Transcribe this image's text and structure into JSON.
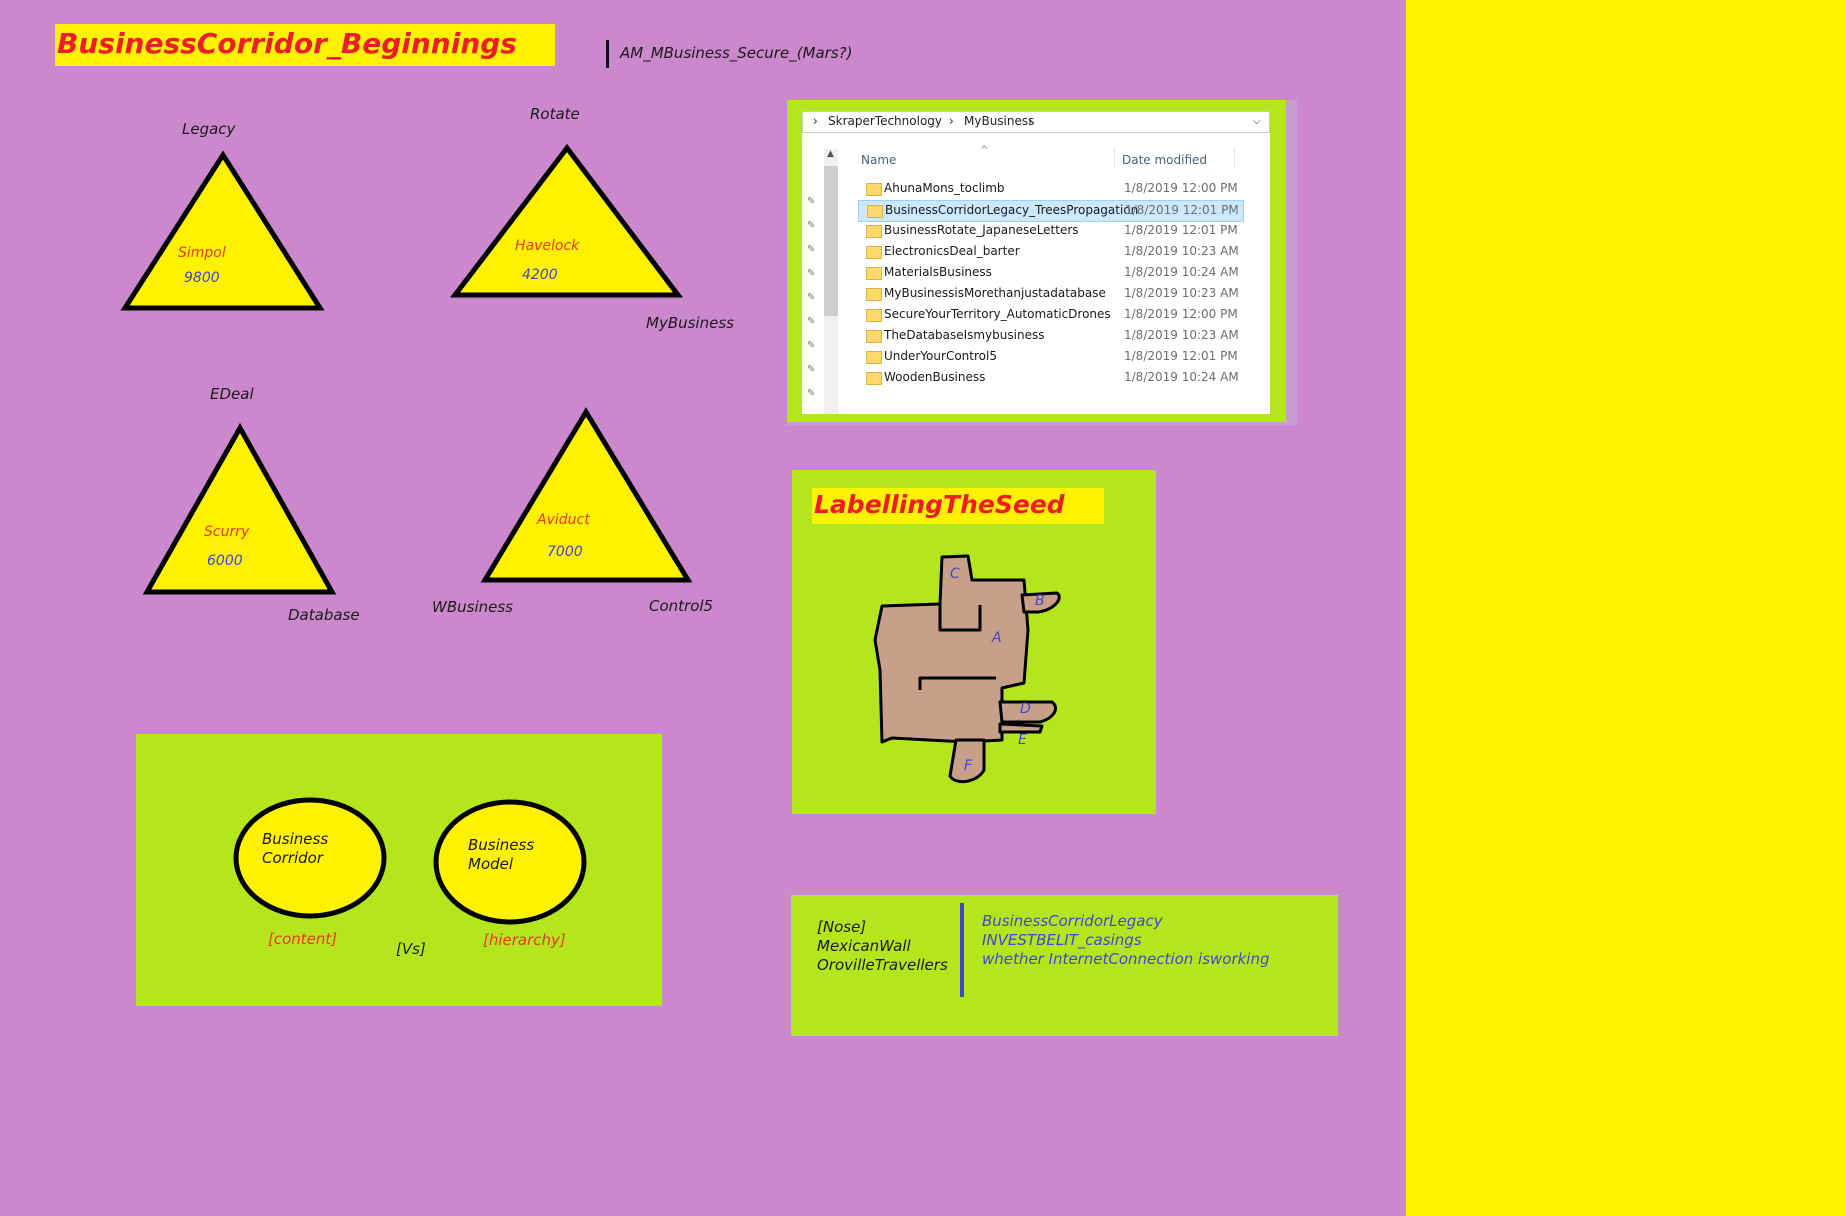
{
  "main_title": "BusinessCorridor_Beginnings",
  "subtitle": "AM_MBusiness_Secure_(Mars?)",
  "triangles": [
    {
      "top_label": "Legacy",
      "name": "Simpol",
      "value": "9800"
    },
    {
      "top_label": "Rotate",
      "name": "Havelock",
      "value": "4200",
      "corner_label": "MyBusiness"
    },
    {
      "top_label": "EDeal",
      "name": "Scurry",
      "value": "6000",
      "corner_label": "Database"
    },
    {
      "name": "Aviduct",
      "value": "7000",
      "left_label": "WBusiness",
      "right_label": "Control5"
    }
  ],
  "compare": {
    "left_line1": "Business",
    "left_line2": "Corridor",
    "right_line1": "Business",
    "right_line2": "Model",
    "left_tag": "[content]",
    "middle_tag": "[Vs]",
    "right_tag": "[hierarchy]"
  },
  "explorer": {
    "breadcrumb": [
      "SkraperTechnology",
      "MyBusiness"
    ],
    "columns": {
      "name": "Name",
      "date": "Date modified"
    },
    "rows": [
      {
        "name": "AhunaMons_toclimb",
        "date": "1/8/2019 12:00 PM"
      },
      {
        "name": "BusinessCorridorLegacy_TreesPropagation",
        "date": "1/8/2019 12:01 PM",
        "selected": true
      },
      {
        "name": "BusinessRotate_JapaneseLetters",
        "date": "1/8/2019 12:01 PM"
      },
      {
        "name": "ElectronicsDeal_barter",
        "date": "1/8/2019 10:23 AM"
      },
      {
        "name": "MaterialsBusiness",
        "date": "1/8/2019 10:24 AM"
      },
      {
        "name": "MyBusinessisMorethanjustadatabase",
        "date": "1/8/2019 10:23 AM"
      },
      {
        "name": "SecureYourTerritory_AutomaticDrones",
        "date": "1/8/2019 12:00 PM"
      },
      {
        "name": "TheDatabaseIsmybusiness",
        "date": "1/8/2019 10:23 AM"
      },
      {
        "name": "UnderYourControl5",
        "date": "1/8/2019 12:01 PM"
      },
      {
        "name": "WoodenBusiness",
        "date": "1/8/2019 10:24 AM"
      }
    ]
  },
  "seed": {
    "title": "LabellingTheSeed",
    "letters": [
      "C",
      "B",
      "A",
      "D",
      "E",
      "F"
    ]
  },
  "notes": {
    "left_lines": [
      "[Nose]",
      "MexicanWall",
      "OrovilleTravellers"
    ],
    "right_lines": [
      "BusinessCorridorLegacy",
      "INVESTBELIT_casings",
      "whether InternetConnection isworking"
    ]
  },
  "colors": {
    "background": "#cc88cc",
    "yellow": "#fff200",
    "green": "#b5e61d",
    "title_red": "#ee1c24",
    "label_orange": "#e8391c",
    "value_blue": "#3f48cc"
  }
}
